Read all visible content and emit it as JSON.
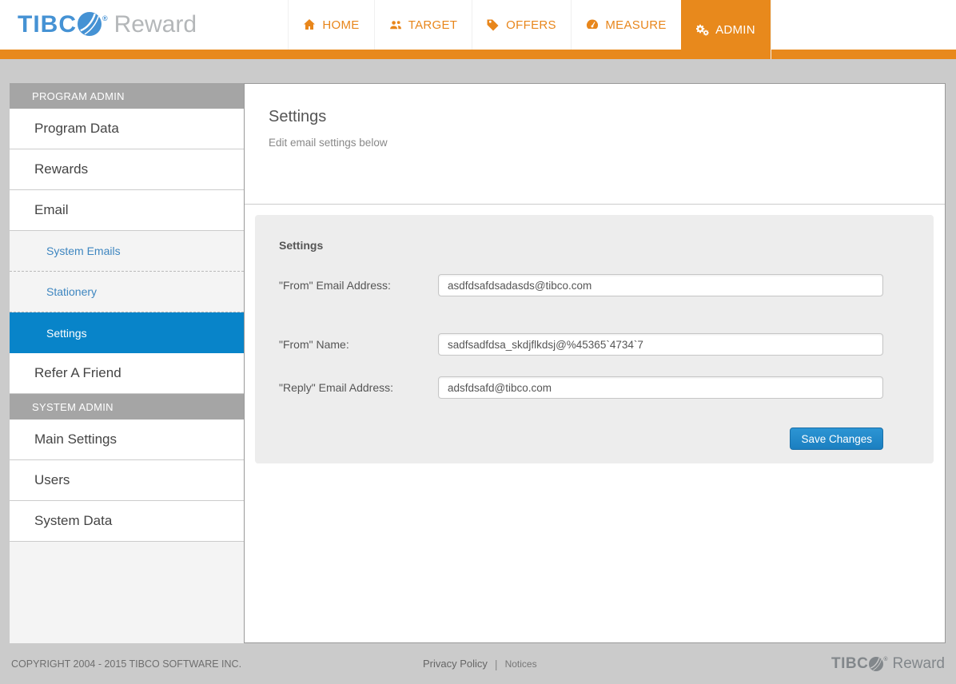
{
  "header": {
    "logo": {
      "wordmark": "TIBC",
      "reg": "®",
      "product": "Reward"
    },
    "nav": [
      {
        "label": "HOME",
        "icon": "home-icon",
        "active": false
      },
      {
        "label": "TARGET",
        "icon": "users-icon",
        "active": false
      },
      {
        "label": "OFFERS",
        "icon": "tag-icon",
        "active": false
      },
      {
        "label": "MEASURE",
        "icon": "gauge-icon",
        "active": false
      },
      {
        "label": "ADMIN",
        "icon": "gears-icon",
        "active": true
      }
    ]
  },
  "sidebar": {
    "section1": {
      "header": "PROGRAM ADMIN",
      "items": [
        {
          "label": "Program Data"
        },
        {
          "label": "Rewards"
        },
        {
          "label": "Email"
        }
      ],
      "subitems": [
        {
          "label": "System Emails",
          "active": false
        },
        {
          "label": "Stationery",
          "active": false
        },
        {
          "label": "Settings",
          "active": true
        }
      ],
      "items_after": [
        {
          "label": "Refer A Friend"
        }
      ]
    },
    "section2": {
      "header": "SYSTEM ADMIN",
      "items": [
        {
          "label": "Main Settings"
        },
        {
          "label": "Users"
        },
        {
          "label": "System Data"
        }
      ]
    }
  },
  "main": {
    "title": "Settings",
    "subtitle": "Edit email settings below",
    "form": {
      "heading": "Settings",
      "fields": [
        {
          "label": "\"From\" Email Address:",
          "value": "asdfdsafdsadasds@tibco.com"
        },
        {
          "label": "\"From\" Name:",
          "value": "sadfsadfdsa_skdjflkdsj@%45365`4734`7"
        },
        {
          "label": "\"Reply\" Email Address:",
          "value": "adsfdsafd@tibco.com"
        }
      ],
      "save_label": "Save Changes"
    }
  },
  "footer": {
    "copyright": "COPYRIGHT 2004 - 2015 TIBCO SOFTWARE INC.",
    "links": [
      {
        "label": "Privacy Policy"
      },
      {
        "label": "Notices"
      }
    ],
    "logo": {
      "wordmark": "TIBC",
      "reg": "®",
      "product": "Reward"
    }
  },
  "colors": {
    "accent_orange": "#e8891c",
    "nav_orange_text": "#e8861b",
    "active_item_blue": "#0884c9",
    "sidebar_link_blue": "#3e86c0",
    "save_button_blue": "#1d87c8",
    "logo_blue": "#4592d4"
  }
}
